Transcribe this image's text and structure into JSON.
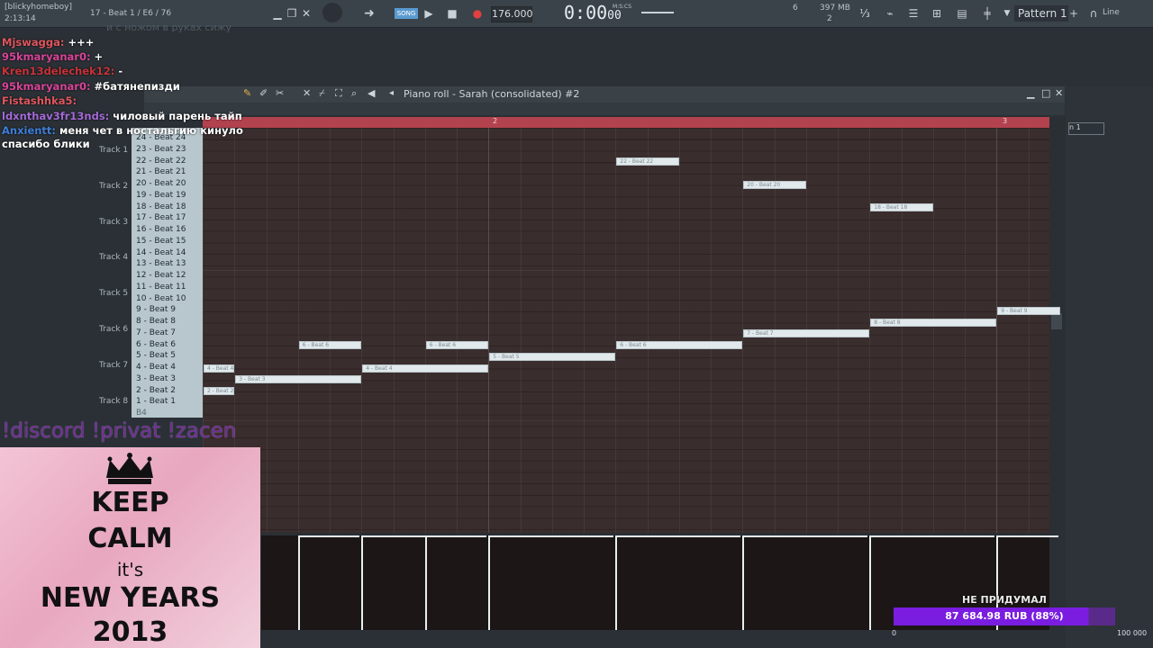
{
  "toolbar": {
    "channel": "[blickyhomeboy]",
    "clock": "2:13:14",
    "hint": "17 - Beat 1 / E6 / 76",
    "mode": "SONG",
    "tempo": "176.000",
    "time": "0:00",
    "time_sub": "00",
    "time_unit": "M:S:CS",
    "cpu": "6",
    "mem": "397 MB",
    "voices": "2",
    "pattern": "Pattern 1",
    "snap": "Line"
  },
  "chat": [
    {
      "user": "Mjswagga:",
      "msg": "+++",
      "color": "#e0565e"
    },
    {
      "user": "95kmaryanar0:",
      "msg": "+",
      "color": "#d9449a"
    },
    {
      "user": "Kren13delechek12:",
      "msg": "-",
      "color": "#c9333a"
    },
    {
      "user": "95kmaryanar0:",
      "msg": "#батянепизди",
      "color": "#d9449a"
    },
    {
      "user": "Fistashhka5:",
      "msg": "",
      "color": "#e0565e"
    },
    {
      "user": "ldxnthav3fr13nds:",
      "msg": "чиловый парень тайп",
      "color": "#a46ad9"
    },
    {
      "user": "Anxientt:",
      "msg": "меня чет в ностальгию кинуло",
      "color": "#3f7ed8"
    },
    {
      "user": "",
      "msg": "спасибо блики",
      "color": "#ffffff"
    }
  ],
  "chat_faded": "и с ножом в руках сижу",
  "piano_roll": {
    "title": "Piano roll - Sarah (consolidated) #2",
    "ruler_marks": [
      "2",
      "3"
    ],
    "keys": [
      "24 - Beat 24",
      "23 - Beat 23",
      "22 - Beat 22",
      "21 - Beat 21",
      "20 - Beat 20",
      "19 - Beat 19",
      "18 - Beat 18",
      "17 - Beat 17",
      "16 - Beat 16",
      "15 - Beat 15",
      "14 - Beat 14",
      "13 - Beat 13",
      "12 - Beat 12",
      "11 - Beat 11",
      "10 - Beat 10",
      "9 - Beat 9",
      "8 - Beat 8",
      "7 - Beat 7",
      "6 - Beat 6",
      "5 - Beat 5",
      "4 - Beat 4",
      "3 - Beat 3",
      "2 - Beat 2",
      "1 - Beat 1"
    ],
    "bottom_key": "B4",
    "tracks": [
      "Track 1",
      "Track 2",
      "Track 3",
      "Track 4",
      "Track 5",
      "Track 6",
      "Track 7",
      "Track 8"
    ],
    "notes": [
      {
        "label": "2 - Beat 2",
        "key": 2,
        "start": 0,
        "len": 1
      },
      {
        "label": "4 - Beat 4",
        "key": 4,
        "start": 0,
        "len": 1
      },
      {
        "label": "3 - Beat 3",
        "key": 3,
        "start": 1,
        "len": 4
      },
      {
        "label": "6 - Beat 6",
        "key": 6,
        "start": 3,
        "len": 2
      },
      {
        "label": "4 - Beat 4",
        "key": 4,
        "start": 5,
        "len": 4
      },
      {
        "label": "6 - Beat 6",
        "key": 6,
        "start": 7,
        "len": 2
      },
      {
        "label": "5 - Beat 5",
        "key": 5,
        "start": 9,
        "len": 4
      },
      {
        "label": "6 - Beat 6",
        "key": 6,
        "start": 13,
        "len": 4
      },
      {
        "label": "22 - Beat 22",
        "key": 22,
        "start": 13,
        "len": 2
      },
      {
        "label": "7 - Beat 7",
        "key": 7,
        "start": 17,
        "len": 4
      },
      {
        "label": "20 - Beat 20",
        "key": 20,
        "start": 17,
        "len": 2
      },
      {
        "label": "8 - Beat 8",
        "key": 8,
        "start": 21,
        "len": 4
      },
      {
        "label": "18 - Beat 18",
        "key": 18,
        "start": 21,
        "len": 2
      },
      {
        "label": "9 - Beat 9",
        "key": 9,
        "start": 25,
        "len": 2
      }
    ]
  },
  "overlay": {
    "discord": "!discord !privat !zacen",
    "poster": [
      "KEEP",
      "CALM",
      "it's",
      "NEW YEARS",
      "2013"
    ],
    "goal_title": "НЕ ПРИДУМАЛ",
    "goal_value": "87 684.98 RUB (88%)",
    "goal_progress": 0.88,
    "goal_min": "0",
    "goal_max": "100 000"
  }
}
